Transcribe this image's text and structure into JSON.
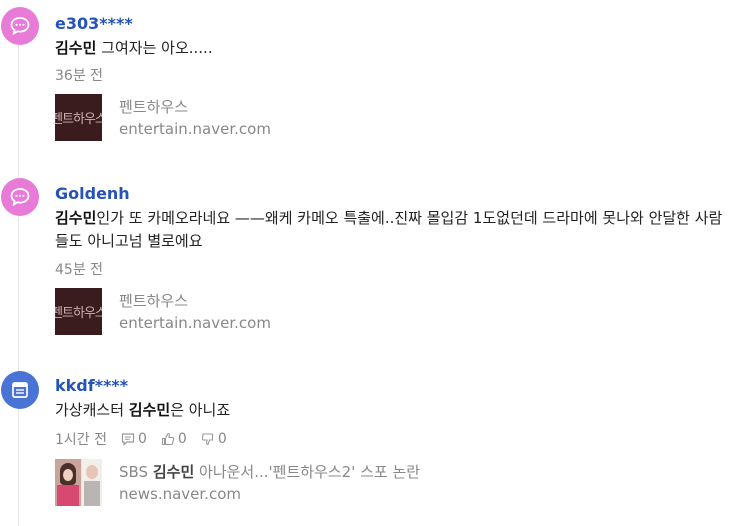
{
  "comments": [
    {
      "username": "e303****",
      "avatar_icon": "speech-bubble-icon",
      "avatar_color": "#e87bd7",
      "text_highlight": "김수민",
      "text_rest": " 그여자는 아오.....",
      "time": "36분 전",
      "link": {
        "thumb_text": "펜트하우스",
        "title": "펜트하우스",
        "domain": "entertain.naver.com"
      }
    },
    {
      "username": "Goldenh",
      "avatar_icon": "speech-bubble-icon",
      "avatar_color": "#e87bd7",
      "text_highlight": "김수민",
      "text_rest": "인가 또 카메오라네요 ——왜케 카메오 특출에..진짜 몰입감 1도없던데 드라마에 못나와 안달한 사람들도 아니고넘 별로에요",
      "time": "45분 전",
      "link": {
        "thumb_text": "펜트하우스",
        "title": "펜트하우스",
        "domain": "entertain.naver.com"
      }
    },
    {
      "username": "kkdf****",
      "avatar_icon": "news-icon",
      "avatar_color": "#4a73d6",
      "text_prefix": "가상캐스터 ",
      "text_highlight": "김수민",
      "text_rest": "은 아니죠",
      "time": "1시간 전",
      "replies": "0",
      "likes": "0",
      "dislikes": "0",
      "link": {
        "title_prefix": "SBS ",
        "title_highlight": "김수민",
        "title_rest": " 아나운서...'펜트하우스2' 스포 논란",
        "domain": "news.naver.com"
      }
    }
  ]
}
